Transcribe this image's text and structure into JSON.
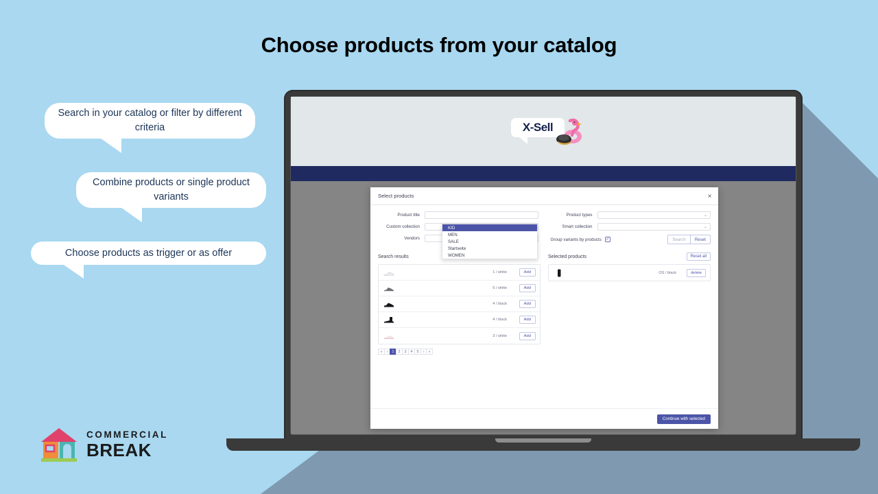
{
  "headline": "Choose products from your catalog",
  "callouts": [
    {
      "id": "bubble1",
      "text": "Search in your catalog or filter by different criteria"
    },
    {
      "id": "bubble2",
      "text": "Combine products or single product variants"
    },
    {
      "id": "bubble3",
      "text": "Choose products as trigger or as offer"
    }
  ],
  "app": {
    "logo_text": "X-Sell",
    "logo_icon": "flamingo-float-icon",
    "navbar_color": "#1f2a60",
    "topbar_color": "#e2e7e9",
    "body_color": "#858585"
  },
  "modal": {
    "title": "Select products",
    "close_icon": "close-icon",
    "filters": {
      "left": [
        {
          "label": "Product title",
          "type": "text",
          "value": ""
        },
        {
          "label": "Custom collection",
          "type": "select",
          "value": "",
          "open": true
        },
        {
          "label": "Vendors",
          "type": "select",
          "value": ""
        }
      ],
      "right": [
        {
          "label": "Product types",
          "type": "select",
          "value": ""
        },
        {
          "label": "Smart collection",
          "type": "select",
          "value": ""
        }
      ],
      "dropdown_options": [
        "KID",
        "MEN",
        "SALE",
        "Startseite",
        "WOMEN"
      ],
      "dropdown_selected": "KID",
      "group_variants_label": "Group variants by products",
      "group_variants_checked": true,
      "search_label": "Search",
      "reset_label": "Reset"
    },
    "search_results": {
      "title": "Search results",
      "rows": [
        {
          "thumb": "sneaker-white-icon",
          "variant": "1 / white",
          "action": "Add",
          "two_lines": false
        },
        {
          "thumb": "sneaker-grey-icon",
          "variant": "5 / white",
          "action": "Add",
          "two_lines": false
        },
        {
          "thumb": "sneaker-black-icon",
          "variant": "4 / black",
          "action": "Add",
          "two_lines": true
        },
        {
          "thumb": "boot-black-icon",
          "variant": "4 / black",
          "action": "Add",
          "two_lines": true
        },
        {
          "thumb": "sneaker-pink-icon",
          "variant": "3 / white",
          "action": "Add",
          "two_lines": true
        }
      ],
      "pagination": [
        "«",
        "‹",
        "1",
        "2",
        "3",
        "4",
        "5",
        "›",
        "»"
      ],
      "active_page": "1"
    },
    "selected_products": {
      "title": "Selected products",
      "reset_all_label": "Reset all",
      "rows": [
        {
          "thumb": "bottle-black-icon",
          "variant": "OS / black",
          "action": "delete"
        }
      ]
    },
    "continue_label": "Continue with selected"
  },
  "brand": {
    "icon": "shop-house-icon",
    "line1": "COMMERCIAL",
    "line2": "BREAK"
  },
  "colors": {
    "background": "#a9d8f0",
    "shadow": "#7f9ab0",
    "accent": "#4c54a8",
    "navy": "#1f2a60",
    "bubble_text": "#1c3557"
  }
}
